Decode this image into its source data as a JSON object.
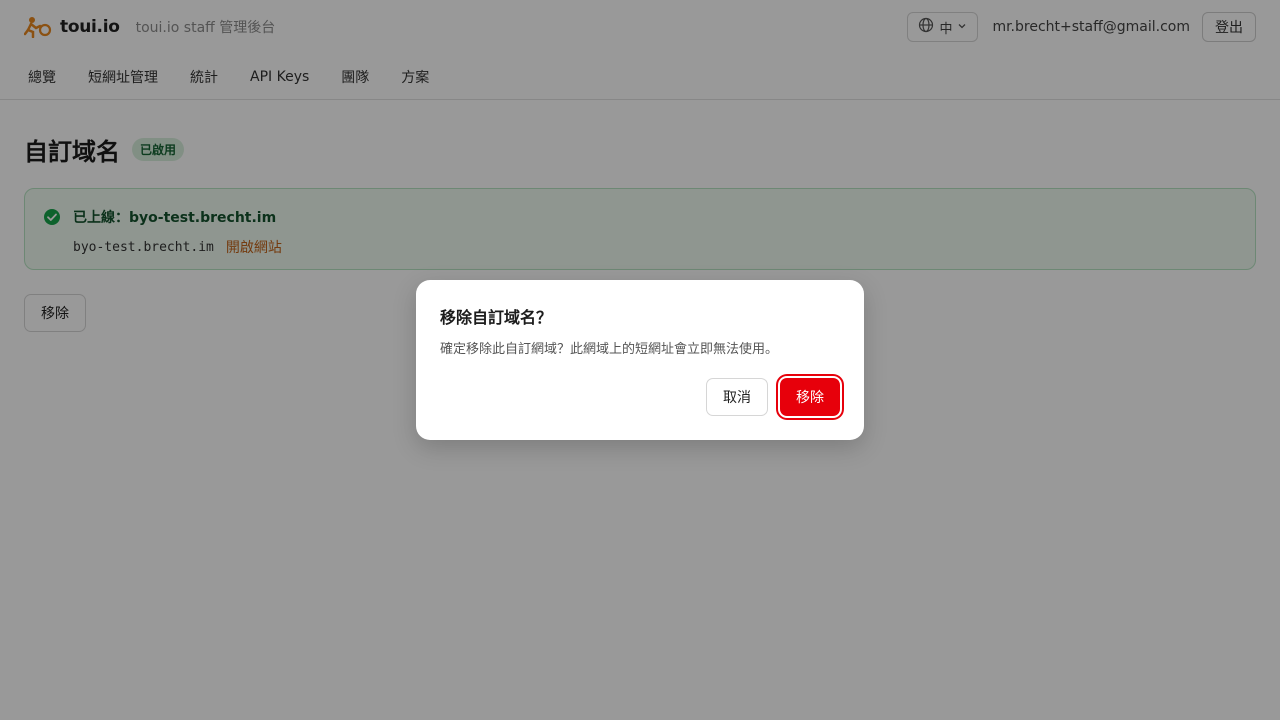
{
  "header": {
    "brand": "toui.io",
    "subtitle": "toui.io staff 管理後台",
    "language_label": "中",
    "user_email": "mr.brecht+staff@gmail.com",
    "logout_label": "登出"
  },
  "nav": {
    "items": [
      {
        "label": "總覽"
      },
      {
        "label": "短網址管理"
      },
      {
        "label": "統計"
      },
      {
        "label": "API Keys"
      },
      {
        "label": "團隊"
      },
      {
        "label": "方案"
      }
    ]
  },
  "page": {
    "title": "自訂域名",
    "status_badge": "已啟用",
    "status_card": {
      "title": "已上線：byo-test.brecht.im",
      "domain": "byo-test.brecht.im",
      "open_link": "開啟網站"
    },
    "remove_label": "移除"
  },
  "dialog": {
    "title": "移除自訂域名？",
    "description": "確定移除此自訂網域？此網域上的短網址會立即無法使用。",
    "cancel_label": "取消",
    "confirm_label": "移除"
  },
  "colors": {
    "brand_accent": "#e8871e",
    "danger": "#e7000b",
    "success": "#16a34a"
  }
}
